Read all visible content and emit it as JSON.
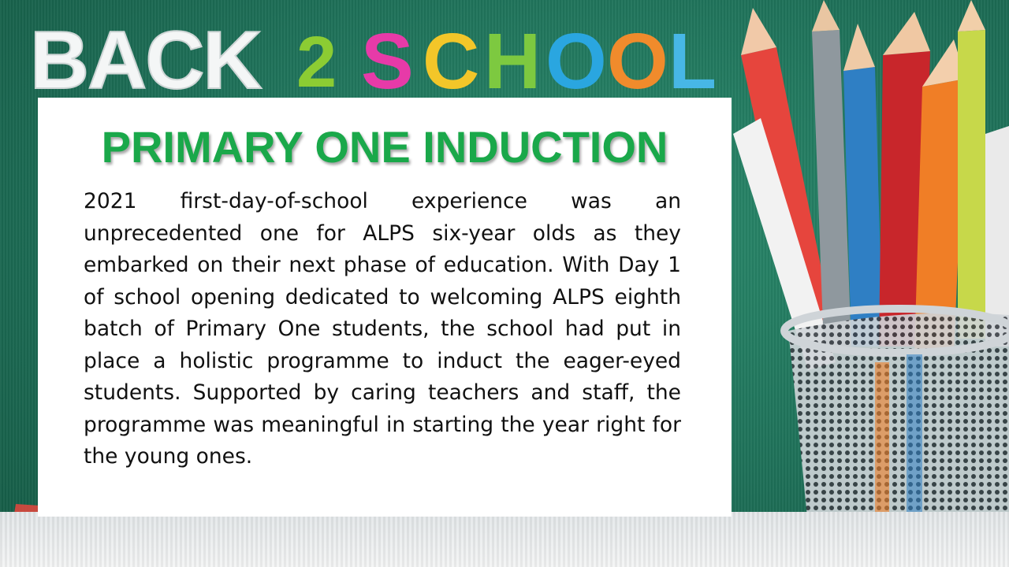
{
  "banner": {
    "back_text": "BACK",
    "digit_text": "2",
    "school_letters": [
      {
        "char": "S",
        "color": "#e73aa8"
      },
      {
        "char": "C",
        "color": "#f3c629"
      },
      {
        "char": "H",
        "color": "#7dc940"
      },
      {
        "char": "O",
        "color": "#2aa6e0"
      },
      {
        "char": "O",
        "color": "#f08b2c"
      },
      {
        "char": "L",
        "color": "#47b7e6"
      }
    ],
    "back_color": "#f4f6f6",
    "digit_color": "#8ccc33"
  },
  "card": {
    "heading": "PRIMARY ONE INDUCTION",
    "body": "2021 first-day-of-school experience was an unprecedented one for ALPS six-year olds as they embarked on their next phase of education. With Day 1 of school opening dedicated to welcoming ALPS eighth batch of Primary One students, the school had put in place a holistic programme to induct the eager-eyed students. Supported by caring teachers and staff, the programme was meaningful in starting the year right for the young ones."
  },
  "colors": {
    "heading_green": "#1aa84a",
    "chalkboard": "#1e7058"
  },
  "pencil_colors": [
    "#e6453d",
    "#f2f2f2",
    "#2f7fc4",
    "#9aa3a8",
    "#d62b2b",
    "#f07e26",
    "#7dc940",
    "#f5d53a",
    "#2aa6e0",
    "#c0392b"
  ]
}
